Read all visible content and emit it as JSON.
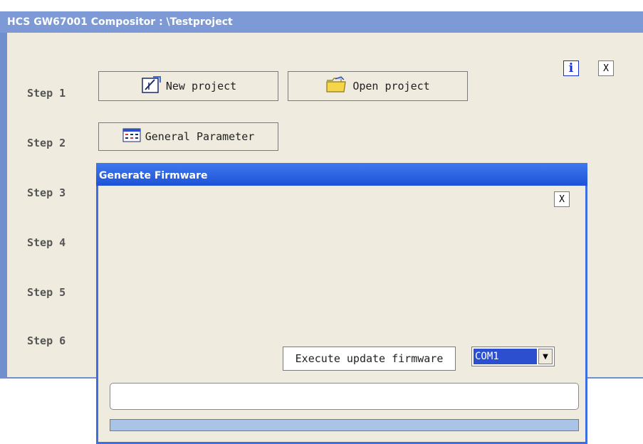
{
  "main_window": {
    "title": "HCS GW67001 Compositor : \\Testproject",
    "info_label": "i",
    "close_label": "X",
    "steps": [
      "Step 1",
      "Step 2",
      "Step 3",
      "Step 4",
      "Step 5",
      "Step 6"
    ],
    "new_project_label": "New project",
    "open_project_label": "Open project",
    "general_parameter_label": "General Parameter"
  },
  "dialog": {
    "title": "Generate Firmware",
    "close_label": "X",
    "execute_label": "Execute update firmware",
    "port_selected": "COM1",
    "port_arrow": "▼",
    "input_value": "",
    "progress_fraction": 1.0
  },
  "colors": {
    "accent": "#3d6fe0",
    "background": "#efebde"
  },
  "icons": {
    "new_project": "new-project-icon",
    "open_project": "folder-open-icon",
    "general_parameter": "parameter-table-icon"
  }
}
